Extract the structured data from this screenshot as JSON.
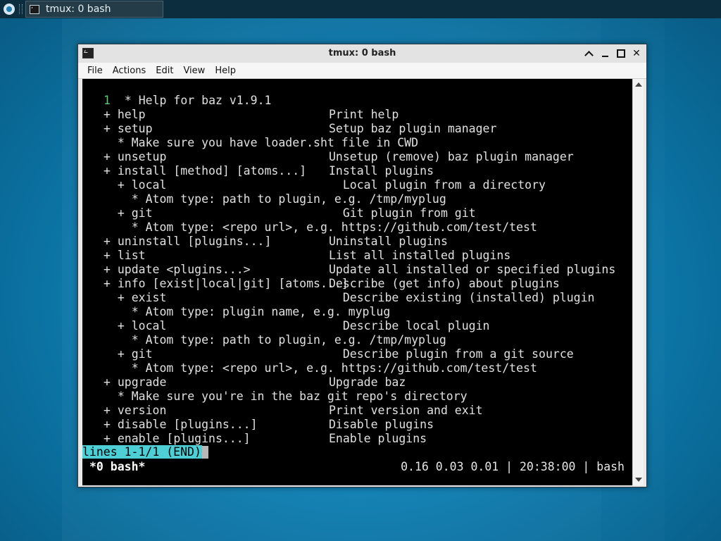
{
  "taskbar": {
    "task_label": "tmux: 0 bash"
  },
  "window": {
    "title": "tmux: 0 bash",
    "menu": [
      "File",
      "Actions",
      "Edit",
      "View",
      "Help"
    ]
  },
  "terminal": {
    "line_number": "1",
    "lines": [
      {
        "left": "  * Help for baz v1.9.1",
        "right": ""
      },
      {
        "left": "+ help",
        "right": "Print help"
      },
      {
        "left": "+ setup",
        "right": "Setup baz plugin manager"
      },
      {
        "left": "  * Make sure you have loader.sht file in CWD",
        "right": ""
      },
      {
        "left": "+ unsetup",
        "right": "Unsetup (remove) baz plugin manager"
      },
      {
        "left": "+ install [method] [atoms...]",
        "right": "Install plugins"
      },
      {
        "left": "  + local",
        "right": "  Local plugin from a directory"
      },
      {
        "left": "    * Atom type: path to plugin, e.g. /tmp/myplug",
        "right": ""
      },
      {
        "left": "  + git",
        "right": "  Git plugin from git"
      },
      {
        "left": "    * Atom type: <repo url>, e.g. https://github.com/test/test",
        "right": ""
      },
      {
        "left": "+ uninstall [plugins...]",
        "right": "Uninstall plugins"
      },
      {
        "left": "+ list",
        "right": "List all installed plugins"
      },
      {
        "left": "+ update <plugins...>",
        "right": "Update all installed or specified plugins"
      },
      {
        "left": "+ info [exist|local|git] [atoms...]",
        "right": "Describe (get info) about plugins"
      },
      {
        "left": "  + exist",
        "right": "  Describe existing (installed) plugin"
      },
      {
        "left": "    * Atom type: plugin name, e.g. myplug",
        "right": ""
      },
      {
        "left": "  + local",
        "right": "  Describe local plugin"
      },
      {
        "left": "    * Atom type: path to plugin, e.g. /tmp/myplug",
        "right": ""
      },
      {
        "left": "  + git",
        "right": "  Describe plugin from a git source"
      },
      {
        "left": "    * Atom type: <repo url>, e.g. https://github.com/test/test",
        "right": ""
      },
      {
        "left": "+ upgrade",
        "right": "Upgrade baz"
      },
      {
        "left": "  * Make sure you're in the baz git repo's directory",
        "right": ""
      },
      {
        "left": "+ version",
        "right": "Print version and exit"
      },
      {
        "left": "+ disable [plugins...]",
        "right": "Disable plugins"
      },
      {
        "left": "+ enable [plugins...]",
        "right": "Enable plugins"
      }
    ],
    "pager_status": "lines 1-1/1 (END)",
    "tmux_window": "*0 bash*",
    "tmux_status": "0.16 0.03 0.01 | 20:38:00 | bash"
  }
}
